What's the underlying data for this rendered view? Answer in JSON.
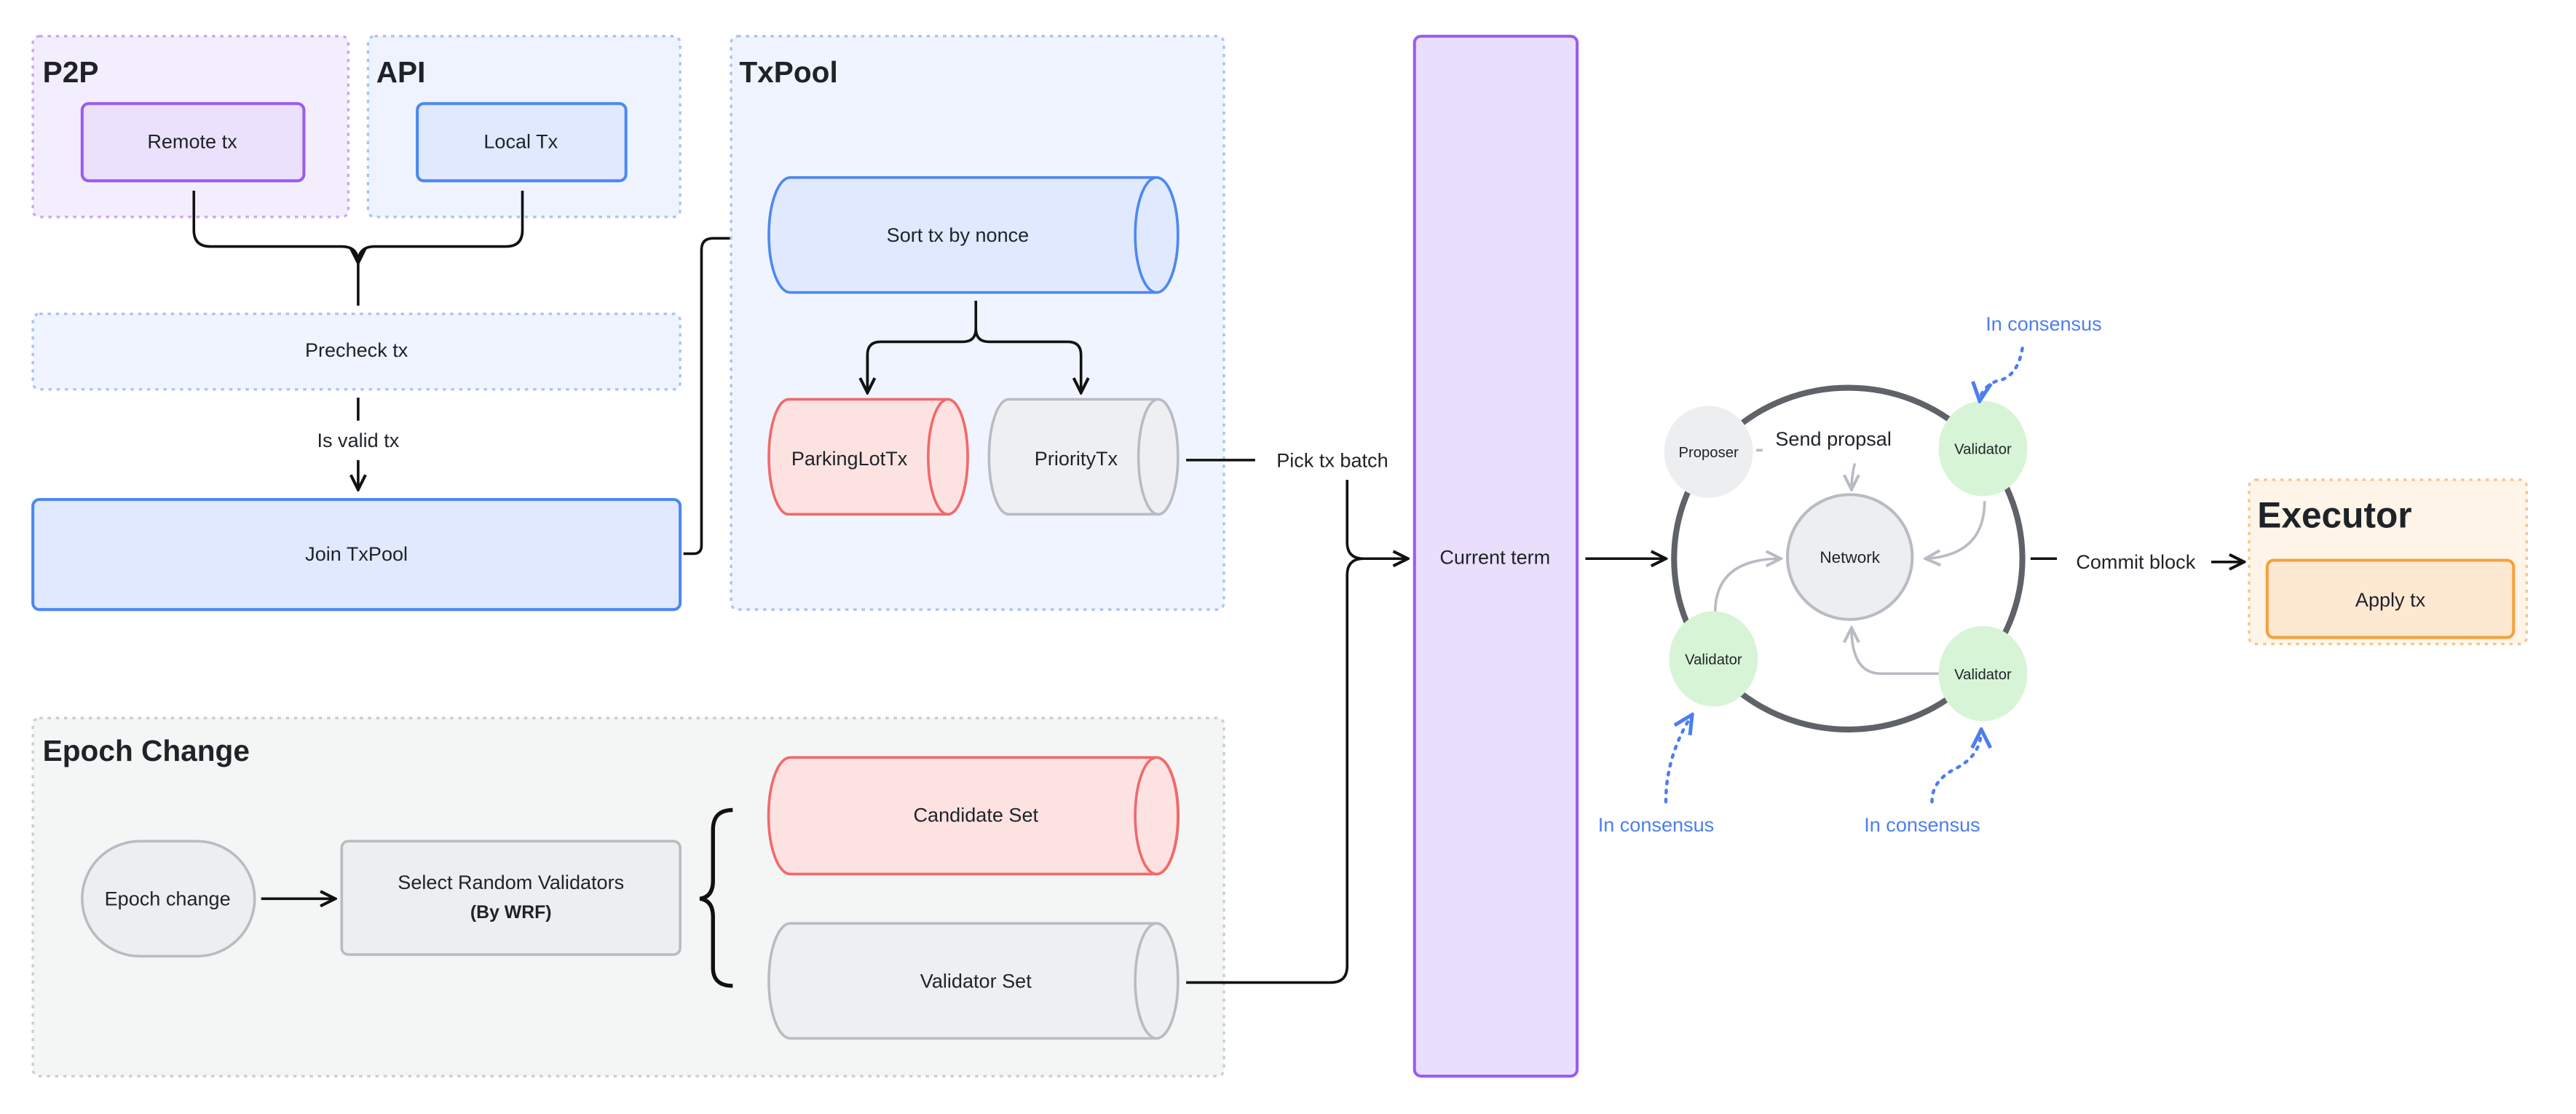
{
  "groups": {
    "p2p": {
      "title": "P2P",
      "node": "Remote tx"
    },
    "api": {
      "title": "API",
      "node": "Local Tx"
    },
    "txpool": {
      "title": "TxPool",
      "sort": "Sort tx by nonce",
      "parking": "ParkingLotTx",
      "priority": "PriorityTx"
    },
    "epoch": {
      "title": "Epoch Change",
      "start": "Epoch change",
      "select": "Select Random Validators",
      "select_sub": "(By WRF)",
      "candidate": "Candidate Set",
      "validator_set": "Validator Set"
    },
    "executor": {
      "title": "Executor",
      "node": "Apply tx"
    }
  },
  "precheck": "Precheck tx",
  "valid_label": "Is valid tx",
  "join": "Join TxPool",
  "pick_label": "Pick tx batch",
  "current_term": "Current term",
  "consensus": {
    "proposer": "Proposer",
    "validators": [
      "Validator",
      "Validator",
      "Validator"
    ],
    "network": "Network",
    "send_label": "Send propsal",
    "in_consensus": [
      "In consensus",
      "In consensus",
      "In consensus"
    ]
  },
  "commit_label": "Commit block",
  "colors": {
    "purple": "#9a5cf0",
    "blue": "#4d88f0",
    "red": "#f06a6a",
    "gray": "#b8bcc2",
    "green": "#d8f4d6",
    "orange": "#f6a03c",
    "annotation": "#4d7ef0"
  }
}
